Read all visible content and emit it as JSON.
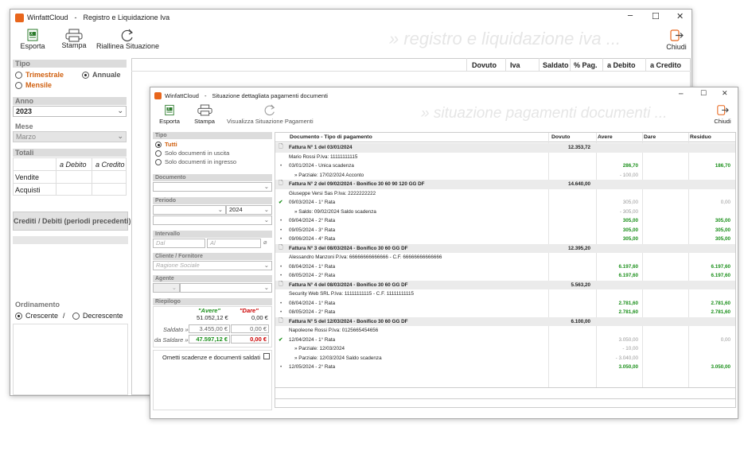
{
  "main": {
    "app": "WinfattCloud",
    "sep": "-",
    "title": "Registro e Liquidazione Iva",
    "min": "─",
    "max": "☐",
    "close": "✕",
    "toolbar": {
      "export": "Esporta",
      "print": "Stampa",
      "realign": "Riallinea Situazione",
      "close": "Chiudi"
    },
    "watermark": "» registro e liquidazione iva ...",
    "tipo": {
      "header": "Tipo",
      "trimestrale": "Trimestrale",
      "annuale": "Annuale",
      "mensile": "Mensile"
    },
    "anno": {
      "header": "Anno",
      "value": "2023"
    },
    "mese": {
      "header": "Mese",
      "value": "Marzo"
    },
    "totali": {
      "header": "Totali",
      "col1": "a Debito",
      "col2": "a Credito",
      "row1": "Vendite",
      "row2": "Acquisti"
    },
    "crediti_button": "Crediti / Debiti (periodi precedenti)",
    "ordinamento": {
      "header": "Ordinamento",
      "crescente": "Crescente",
      "slash": "/",
      "decrescente": "Decrescente"
    },
    "columns": {
      "dovuto": "Dovuto",
      "iva": "Iva",
      "saldato": "Saldato",
      "pag": "% Pag.",
      "debito": "a Debito",
      "credito": "a Credito"
    }
  },
  "detail": {
    "app": "WinfattCloud",
    "sep": "-",
    "title": "Situazione dettagliata pagamenti documenti",
    "min": "─",
    "max": "☐",
    "close": "✕",
    "toolbar": {
      "export": "Esporta",
      "print": "Stampa",
      "view": "Visualizza Situazione Pagamenti",
      "close": "Chiudi"
    },
    "watermark": "» situazione pagamenti documenti ...",
    "tipo": {
      "header": "Tipo",
      "tutti": "Tutti",
      "uscita": "Solo documenti in uscita",
      "ingresso": "Solo documenti in ingresso"
    },
    "documento": {
      "header": "Documento"
    },
    "periodo": {
      "header": "Periodo",
      "year": "2024"
    },
    "intervallo": {
      "header": "Intervallo",
      "dal": "Dal",
      "al": "Al"
    },
    "cliente": {
      "header": "Cliente / Fornitore",
      "placeholder": "Ragione Sociale"
    },
    "agente": {
      "header": "Agente"
    },
    "riepilogo": {
      "header": "Riepilogo",
      "avere": "\"Avere\"",
      "dare": "\"Dare\"",
      "avere_val": "51.052,12 €",
      "dare_val": "0,00 €",
      "saldato_lbl": "Saldato »",
      "saldato_avere": "3.455,00 €",
      "saldato_dare": "0,00 €",
      "dasaldare_lbl": "da Saldare »",
      "dasaldare_avere": "47.597,12 €",
      "dasaldare_dare": "0,00 €"
    },
    "ometti": "Ometti scadenze e documenti saldati",
    "table": {
      "headers": {
        "doc": "Documento - Tipo di pagamento",
        "dovuto": "Dovuto",
        "avere": "Avere",
        "dare": "Dare",
        "residuo": "Residuo"
      },
      "rows": [
        {
          "k": "h",
          "icon": "doc",
          "doc": "Fattura N° 1 del 03/01/2024",
          "dovuto": "12.353,72"
        },
        {
          "k": "s",
          "doc": "Mario Rossi P.Iva: 11111111115"
        },
        {
          "k": "r",
          "icon": "dot",
          "doc": "03/01/2024 - Unica scadenza",
          "avere": "286,70",
          "ac": "green",
          "residuo": "186,70",
          "rc": "green"
        },
        {
          "k": "p",
          "doc": "» Parziale:  17/02/2024 Acconto",
          "avere": "- 100,00",
          "ac": "gray"
        },
        {
          "k": "h",
          "icon": "doc",
          "doc": "Fattura N° 2 del 09/02/2024 - Bonifico 30 60 90 120 GG DF",
          "dovuto": "14.640,00"
        },
        {
          "k": "s",
          "doc": "Giuseppe Versi Sas P.Iva: 2222222222"
        },
        {
          "k": "r",
          "icon": "check",
          "doc": "09/03/2024 - 1° Rata",
          "avere": "305,00",
          "ac": "gray",
          "residuo": "0,00",
          "rc": "gray"
        },
        {
          "k": "p",
          "doc": "» Saldo:  09/02/2024 Saldo scadenza",
          "avere": "- 305,00",
          "ac": "gray"
        },
        {
          "k": "r",
          "icon": "dot",
          "doc": "09/04/2024 - 2° Rata",
          "avere": "305,00",
          "ac": "green",
          "residuo": "305,00",
          "rc": "green"
        },
        {
          "k": "r",
          "icon": "dot",
          "doc": "09/05/2024 - 3° Rata",
          "avere": "305,00",
          "ac": "green",
          "residuo": "305,00",
          "rc": "green"
        },
        {
          "k": "r",
          "icon": "dot",
          "doc": "09/06/2024 - 4° Rata",
          "avere": "305,00",
          "ac": "green",
          "residuo": "305,00",
          "rc": "green"
        },
        {
          "k": "h",
          "icon": "doc",
          "doc": "Fattura N° 3 del 08/03/2024 - Bonifico 30 60 GG DF",
          "dovuto": "12.395,20"
        },
        {
          "k": "s",
          "doc": "Alessandro Manzoni P.Iva: 66666666666666 - C.F. 66666666666666"
        },
        {
          "k": "r",
          "icon": "dot",
          "doc": "08/04/2024 - 1° Rata",
          "avere": "6.197,60",
          "ac": "green",
          "residuo": "6.197,60",
          "rc": "green"
        },
        {
          "k": "r",
          "icon": "dot",
          "doc": "08/05/2024 - 2° Rata",
          "avere": "6.197,60",
          "ac": "green",
          "residuo": "6.197,60",
          "rc": "green"
        },
        {
          "k": "h",
          "icon": "doc",
          "doc": "Fattura N° 4 del 08/03/2024 - Bonifico 30 60 GG DF",
          "dovuto": "5.563,20"
        },
        {
          "k": "s",
          "doc": "Security Web SRL P.Iva: 11111111115 - C.F. 11111111115"
        },
        {
          "k": "r",
          "icon": "dot",
          "doc": "08/04/2024 - 1° Rata",
          "avere": "2.781,60",
          "ac": "green",
          "residuo": "2.781,60",
          "rc": "green"
        },
        {
          "k": "r",
          "icon": "dot",
          "doc": "08/05/2024 - 2° Rata",
          "avere": "2.781,60",
          "ac": "green",
          "residuo": "2.781,60",
          "rc": "green"
        },
        {
          "k": "h",
          "icon": "doc",
          "doc": "Fattura N° 5 del 12/03/2024 - Bonifico 30 60 GG DF",
          "dovuto": "6.100,00"
        },
        {
          "k": "s",
          "doc": "Napoleone Rossi P.Iva: 0125665454656"
        },
        {
          "k": "r",
          "icon": "check",
          "doc": "12/04/2024 - 1° Rata",
          "avere": "3.050,00",
          "ac": "gray",
          "residuo": "0,00",
          "rc": "gray"
        },
        {
          "k": "p",
          "doc": "» Parziale:  12/03/2024",
          "avere": "- 10,00",
          "ac": "gray"
        },
        {
          "k": "p",
          "doc": "» Parziale:  12/03/2024 Saldo scadenza",
          "avere": "- 3.040,00",
          "ac": "gray"
        },
        {
          "k": "r",
          "icon": "dot",
          "doc": "12/05/2024 - 2° Rata",
          "avere": "3.050,00",
          "ac": "green",
          "residuo": "3.050,00",
          "rc": "green"
        }
      ]
    }
  },
  "colors": {
    "accent": "#e8661c",
    "green": "#1a8f1a",
    "red": "#cc0000",
    "section": "#dcdcdc"
  }
}
